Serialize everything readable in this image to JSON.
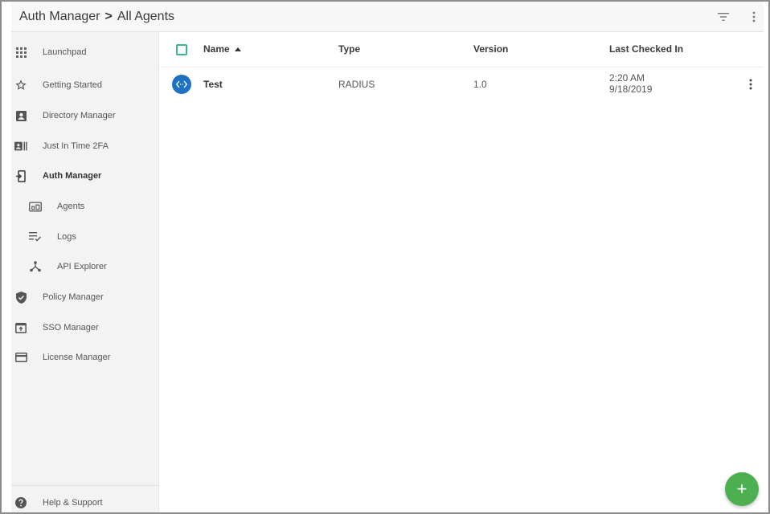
{
  "breadcrumb": {
    "parent": "Auth Manager",
    "separator": ">",
    "current": "All Agents"
  },
  "header": {
    "filter_icon": "filter-icon",
    "more_icon": "more-vert-icon"
  },
  "sidebar": {
    "items": [
      {
        "label": "Launchpad",
        "icon": "apps-grid-icon"
      },
      {
        "label": "Getting Started",
        "icon": "star-icon"
      },
      {
        "label": "Directory Manager",
        "icon": "contact-card-icon"
      },
      {
        "label": "Just In Time 2FA",
        "icon": "badge-icon"
      },
      {
        "label": "Auth Manager",
        "icon": "login-icon",
        "active": true
      },
      {
        "label": "Agents",
        "icon": "agents-icon",
        "sub": true
      },
      {
        "label": "Logs",
        "icon": "list-check-icon",
        "sub": true
      },
      {
        "label": "API Explorer",
        "icon": "hub-icon",
        "sub": true
      },
      {
        "label": "Policy Manager",
        "icon": "shield-check-icon"
      },
      {
        "label": "SSO Manager",
        "icon": "sso-window-icon"
      },
      {
        "label": "License Manager",
        "icon": "credit-card-icon"
      }
    ],
    "footer": {
      "label": "Help & Support",
      "icon": "help-icon"
    }
  },
  "table": {
    "columns": {
      "name": "Name",
      "type": "Type",
      "version": "Version",
      "last_checked_in": "Last Checked In"
    },
    "sort": {
      "column": "Name",
      "direction": "ascending"
    },
    "rows": [
      {
        "name": "Test",
        "type": "RADIUS",
        "version": "1.0",
        "time": "2:20 AM",
        "date": "9/18/2019",
        "icon": "code-arrows-icon"
      }
    ]
  },
  "fab": {
    "label": "+",
    "icon": "add-icon"
  },
  "colors": {
    "accent": "#3cb48c",
    "fab": "#4caf50",
    "agent_icon": "#1e72c4",
    "sidebar_bg": "#f3f3f3"
  }
}
